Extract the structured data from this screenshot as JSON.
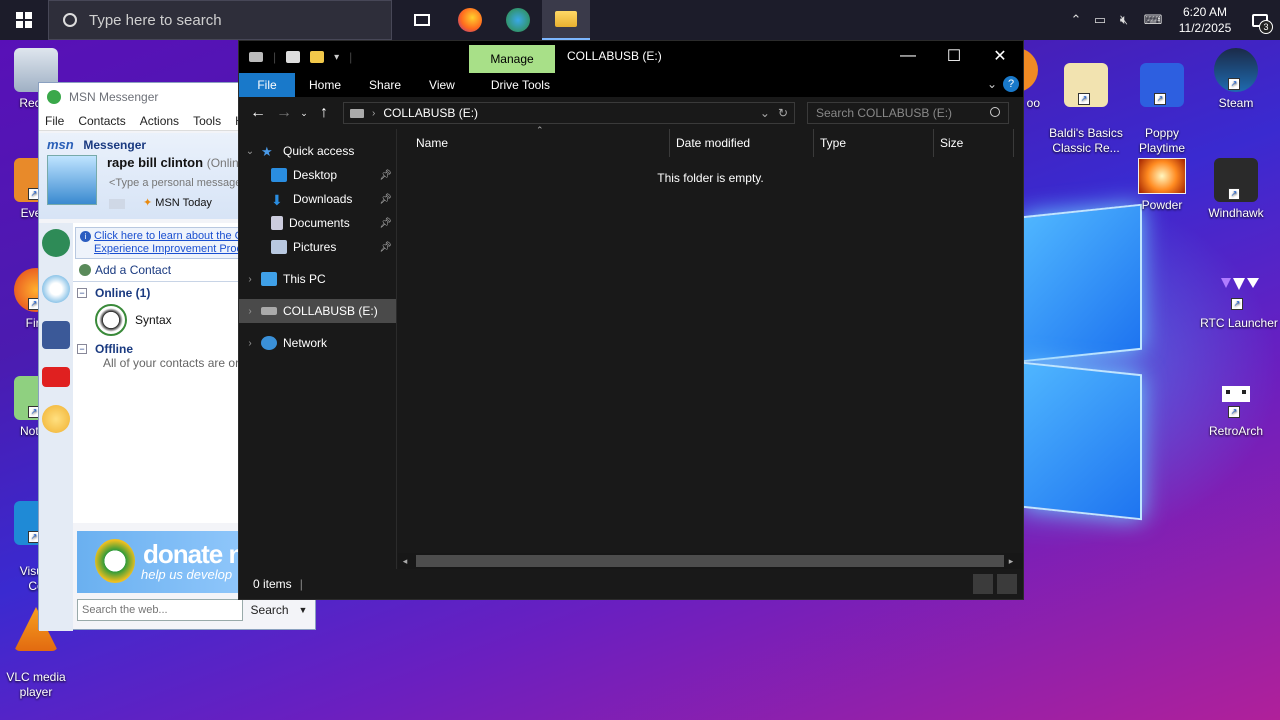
{
  "taskbar": {
    "search_placeholder": "Type here to search",
    "apps": [
      "task-view",
      "firefox",
      "msn-messenger",
      "file-explorer"
    ],
    "clock": {
      "time": "6:20 AM",
      "date": "11/2/2025"
    },
    "notification_count": "3"
  },
  "desktop": {
    "left_icons": [
      {
        "label": "Recyc",
        "icon": "recycle-bin-icon"
      },
      {
        "label": "Every",
        "icon": "everything-icon"
      },
      {
        "label": "Fire",
        "icon": "firefox-icon"
      },
      {
        "label": "Notep",
        "icon": "notepad-icon"
      },
      {
        "label": "Visual\nCo",
        "icon": "vscode-icon"
      },
      {
        "label": "VLC media\nplayer",
        "icon": "vlc-icon"
      }
    ],
    "right_icons": [
      {
        "label": "oo",
        "icon": "partial-icon"
      },
      {
        "label": "Baldi's Basics\nClassic Re...",
        "icon": "baldi-icon"
      },
      {
        "label": "Poppy\nPlaytime",
        "icon": "poppy-icon"
      },
      {
        "label": "Steam",
        "icon": "steam-icon"
      },
      {
        "label": "Powder",
        "icon": "powder-icon"
      },
      {
        "label": "Windhawk",
        "icon": "windhawk-icon"
      },
      {
        "label": "RTC Launcher",
        "icon": "rtc-launcher-icon"
      },
      {
        "label": "RetroArch",
        "icon": "retroarch-icon"
      }
    ]
  },
  "msn": {
    "title": "MSN Messenger",
    "menu": [
      "File",
      "Contacts",
      "Actions",
      "Tools",
      "H"
    ],
    "brand": "msn",
    "brand_suffix": "Messenger",
    "username": "rape bill clinton",
    "status": "(Onlin",
    "personal_message": "<Type a personal message",
    "msn_today": "MSN Today",
    "info_link_1": "Click here to learn about the C",
    "info_link_2": "Experience Improvement Proc",
    "add_contact": "Add a Contact",
    "online_group": "Online (1)",
    "contact_name": "Syntax",
    "offline_group": "Offline",
    "offline_msg": "All of your contacts are or",
    "donate_title": "donate n",
    "donate_sub": "help us develop",
    "search_placeholder": "Search the web...",
    "search_button": "Search"
  },
  "explorer": {
    "manage_tab": "Manage",
    "title": "COLLABUSB (E:)",
    "ribbon_tabs": [
      "File",
      "Home",
      "Share",
      "View",
      "Drive Tools"
    ],
    "address": "COLLABUSB (E:)",
    "search_placeholder": "Search COLLABUSB (E:)",
    "nav_items": {
      "quick_access": "Quick access",
      "desktop": "Desktop",
      "downloads": "Downloads",
      "documents": "Documents",
      "pictures": "Pictures",
      "this_pc": "This PC",
      "collabusb": "COLLABUSB (E:)",
      "network": "Network"
    },
    "columns": [
      "Name",
      "Date modified",
      "Type",
      "Size"
    ],
    "empty_message": "This folder is empty.",
    "status": "0 items"
  }
}
